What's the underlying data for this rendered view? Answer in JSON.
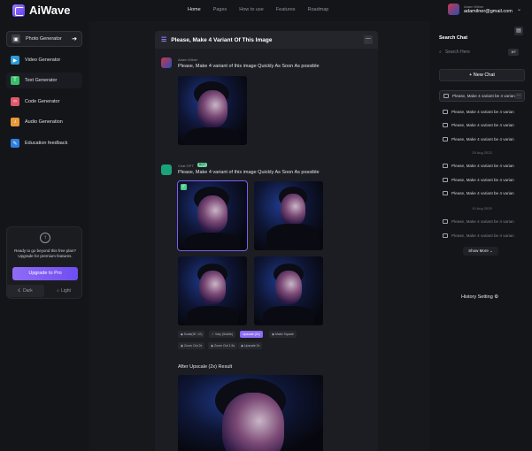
{
  "app": {
    "name": "AiWave"
  },
  "nav": [
    "Home",
    "Pages",
    "How to use",
    "Features",
    "Roadmap"
  ],
  "user": {
    "name": "Adam Milner",
    "email": "adamilner@gmail.com"
  },
  "sidebar": {
    "items": [
      {
        "label": "Photo Generator",
        "icon": "image-icon",
        "color": "#3f4048"
      },
      {
        "label": "Video Generator",
        "icon": "video-icon",
        "color": "#2a9bd8"
      },
      {
        "label": "Text Generator",
        "icon": "text-icon",
        "color": "#3bbf6a"
      },
      {
        "label": "Code Generator",
        "icon": "code-icon",
        "color": "#e0596a"
      },
      {
        "label": "Audio Generation",
        "icon": "audio-icon",
        "color": "#e89a3a"
      },
      {
        "label": "Education feedback",
        "icon": "education-icon",
        "color": "#2f7fe0"
      }
    ],
    "promo_text": "Ready to go beyond this free plan? Upgrade for premium features.",
    "upgrade_label": "Upgrade to Pro",
    "theme_dark": "Dark",
    "theme_light": "Light"
  },
  "chat": {
    "title": "Please, Make 4 Variant Of This Image",
    "user_name": "Adam Milner",
    "user_message": "Please, Make 4 variant of this image Quickly As Soon As possible",
    "bot_name": "Chat GPT",
    "bot_badge": "BOT",
    "bot_message": "Please, Make 4 variant of this image Quickly As Soon As possible",
    "actions_row1": [
      "Scale(ID: 1X)",
      "Vary (Subtle)",
      "Upscale (2x)",
      "Make Square"
    ],
    "actions_row2": [
      "Zoom Out 2x",
      "Zoom Out 1.5x",
      "Upscale 2x"
    ],
    "result_label": "After Upscale (2x) Result"
  },
  "history": {
    "title": "Search Chat",
    "search_placeholder": "Search Here",
    "search_kbd": "⌘F",
    "new_chat": "+ New Chat",
    "item_label": "Please, Make 4 variant be 4 varian",
    "date1": "29 Aug 2023",
    "date2": "10 Aug 2025",
    "show_more": "Show More",
    "history_setting": "History Setting"
  }
}
